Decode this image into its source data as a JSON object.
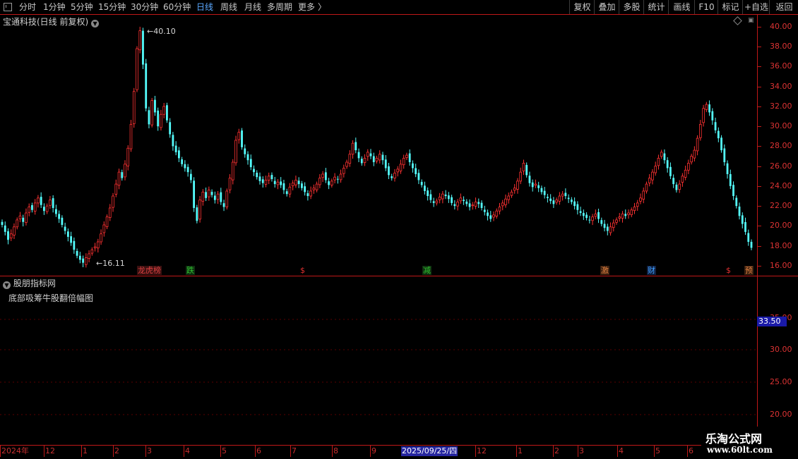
{
  "toolbar": {
    "periods": [
      {
        "label": "分时",
        "active": false
      },
      {
        "label": "1分钟",
        "active": false
      },
      {
        "label": "5分钟",
        "active": false
      },
      {
        "label": "15分钟",
        "active": false
      },
      {
        "label": "30分钟",
        "active": false
      },
      {
        "label": "60分钟",
        "active": false
      },
      {
        "label": "日线",
        "active": true
      },
      {
        "label": "周线",
        "active": false
      },
      {
        "label": "月线",
        "active": false
      },
      {
        "label": "多周期",
        "active": false
      },
      {
        "label": "更多",
        "active": false
      }
    ],
    "more_arrow": "〉",
    "right_buttons": [
      "复权",
      "叠加",
      "多股",
      "统计",
      "画线",
      "F10",
      "标记",
      "+自选",
      "返回"
    ]
  },
  "main_panel": {
    "title": "宝通科技(日线 前复权)",
    "high_label": "40.10",
    "low_label": "16.11",
    "y_ticks": [
      "40.00",
      "38.00",
      "36.00",
      "34.00",
      "32.00",
      "30.00",
      "28.00",
      "26.00",
      "24.00",
      "22.00",
      "20.00",
      "18.00",
      "16.00"
    ],
    "y_range": [
      15.0,
      41.2
    ],
    "markers": [
      {
        "text": "龙虎榜",
        "color": "#d94040",
        "bg": "#3a1010"
      },
      {
        "text": "跌",
        "color": "#30c030",
        "bg": "#0f3010"
      },
      {
        "text": "$",
        "color": "#e03030",
        "bg": "#000"
      },
      {
        "text": "减",
        "color": "#30c030",
        "bg": "#0f3010"
      },
      {
        "text": "激",
        "color": "#e08040",
        "bg": "#3a2010"
      },
      {
        "text": "财",
        "color": "#40a0ff",
        "bg": "#102040"
      },
      {
        "text": "$",
        "color": "#e03030",
        "bg": "#000"
      },
      {
        "text": "预",
        "color": "#e08040",
        "bg": "#3a2010"
      }
    ]
  },
  "indicator_panel": {
    "title": "股朋指标网",
    "subtitle": "底部吸筹牛股翻倍幅图",
    "current_value": "33.50",
    "y_ticks": [
      "35.00",
      "30.00",
      "25.00",
      "20.00"
    ]
  },
  "date_axis": {
    "labels": [
      "2024年",
      "12",
      "1",
      "2",
      "3",
      "4",
      "5",
      "6",
      "7",
      "8",
      "9",
      "12",
      "1",
      "2",
      "3",
      "4",
      "5",
      "6"
    ],
    "highlight": "2025/09/25/四"
  },
  "watermark": {
    "line1": "乐淘公式网",
    "line2": "www.60lt.com"
  },
  "colors": {
    "up": "#ff3232",
    "down": "#54fcfc",
    "axis": "#c01818",
    "accent": "#5aa8ff"
  },
  "chart_data": {
    "type": "candlestick",
    "ylim": [
      15.0,
      41.2
    ],
    "high": 40.1,
    "low": 16.11,
    "closes": [
      20.1,
      19.4,
      18.6,
      19.2,
      19.9,
      20.6,
      21.0,
      20.4,
      21.3,
      21.9,
      21.6,
      22.3,
      22.8,
      22.1,
      21.5,
      22.0,
      22.6,
      21.8,
      21.2,
      20.7,
      20.1,
      19.5,
      18.9,
      18.3,
      17.6,
      17.0,
      16.6,
      16.3,
      16.8,
      17.2,
      17.6,
      17.9,
      18.4,
      19.2,
      20.1,
      20.9,
      21.8,
      23.0,
      24.2,
      25.4,
      24.8,
      26.2,
      27.8,
      30.2,
      33.5,
      37.8,
      39.6,
      36.2,
      31.8,
      30.2,
      32.6,
      31.4,
      30.0,
      31.2,
      32.0,
      30.6,
      29.2,
      28.0,
      27.4,
      26.8,
      26.2,
      25.8,
      25.4,
      24.6,
      21.8,
      20.5,
      22.6,
      23.4,
      22.8,
      23.6,
      23.1,
      22.6,
      23.2,
      22.4,
      21.9,
      23.5,
      24.8,
      26.4,
      28.6,
      29.4,
      27.9,
      27.2,
      26.6,
      25.9,
      25.4,
      24.9,
      24.5,
      24.3,
      24.6,
      25.0,
      24.7,
      24.2,
      24.4,
      24.1,
      23.6,
      23.2,
      23.9,
      24.3,
      24.6,
      24.2,
      23.8,
      23.4,
      23.0,
      23.5,
      23.8,
      24.2,
      24.8,
      25.2,
      24.6,
      24.1,
      24.5,
      24.9,
      24.7,
      25.2,
      25.8,
      26.4,
      27.2,
      28.3,
      27.6,
      26.8,
      26.3,
      26.8,
      27.4,
      27.0,
      26.4,
      26.8,
      27.2,
      26.6,
      25.8,
      25.1,
      24.8,
      25.3,
      25.7,
      26.2,
      26.8,
      27.1,
      26.4,
      25.8,
      25.2,
      24.6,
      24.1,
      23.5,
      23.0,
      22.6,
      22.3,
      22.5,
      22.9,
      23.2,
      23.0,
      22.7,
      22.3,
      22.0,
      22.4,
      22.8,
      22.5,
      22.2,
      21.9,
      22.1,
      22.4,
      22.2,
      21.8,
      21.4,
      21.0,
      20.7,
      21.1,
      21.5,
      21.9,
      22.3,
      22.7,
      23.0,
      23.4,
      23.8,
      24.5,
      25.4,
      26.3,
      25.1,
      24.3,
      23.9,
      24.2,
      23.8,
      23.4,
      23.1,
      22.8,
      22.5,
      22.2,
      22.6,
      23.0,
      23.2,
      23.0,
      22.7,
      22.4,
      22.0,
      21.6,
      21.3,
      21.0,
      20.8,
      20.6,
      20.9,
      21.2,
      20.7,
      20.2,
      19.8,
      19.5,
      19.9,
      20.3,
      20.6,
      20.9,
      21.2,
      21.0,
      21.3,
      21.6,
      21.9,
      22.3,
      22.8,
      23.5,
      24.2,
      24.8,
      25.4,
      26.0,
      26.8,
      27.4,
      26.6,
      25.8,
      25.0,
      24.2,
      23.6,
      24.2,
      25.0,
      25.6,
      26.3,
      27.0,
      27.6,
      28.8,
      30.2,
      31.8,
      32.2,
      31.4,
      30.6,
      29.6,
      28.8,
      27.6,
      26.4,
      25.2,
      24.0,
      23.0,
      22.0,
      21.0,
      20.2,
      19.4,
      18.4,
      17.8
    ]
  }
}
